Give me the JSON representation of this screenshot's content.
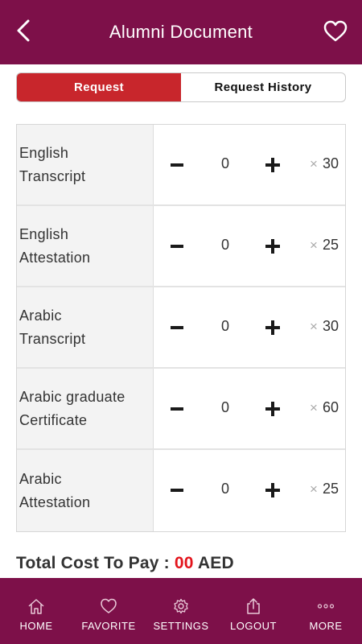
{
  "header": {
    "title": "Alumni Document",
    "back_icon": "chevron-left-icon",
    "favorite_icon": "heart-icon"
  },
  "segment": {
    "request_label": "Request",
    "history_label": "Request History",
    "active": "Request"
  },
  "documents": [
    {
      "name_line1": "English",
      "name_line2": "Transcript",
      "quantity": "0",
      "price": "30"
    },
    {
      "name_line1": "English",
      "name_line2": "Attestation",
      "quantity": "0",
      "price": "25"
    },
    {
      "name_line1": "Arabic",
      "name_line2": "Transcript",
      "quantity": "0",
      "price": "30"
    },
    {
      "name_line1": "Arabic graduate",
      "name_line2": "Certificate",
      "quantity": "0",
      "price": "60"
    },
    {
      "name_line1": "Arabic",
      "name_line2": "Attestation",
      "quantity": "0",
      "price": "25"
    }
  ],
  "multiply_symbol": "×",
  "total": {
    "label": "Total Cost To Pay : ",
    "amount": "00",
    "currency": " AED"
  },
  "tabbar": [
    {
      "label": "HOME",
      "icon": "home-icon"
    },
    {
      "label": "FAVORITE",
      "icon": "heart-icon"
    },
    {
      "label": "SETTINGS",
      "icon": "gear-icon"
    },
    {
      "label": "LOGOUT",
      "icon": "share-icon"
    },
    {
      "label": "MORE",
      "icon": "more-icon"
    }
  ],
  "colors": {
    "brand": "#7d1049",
    "active_tab": "#c8262c",
    "total_amount": "#e3141c"
  }
}
